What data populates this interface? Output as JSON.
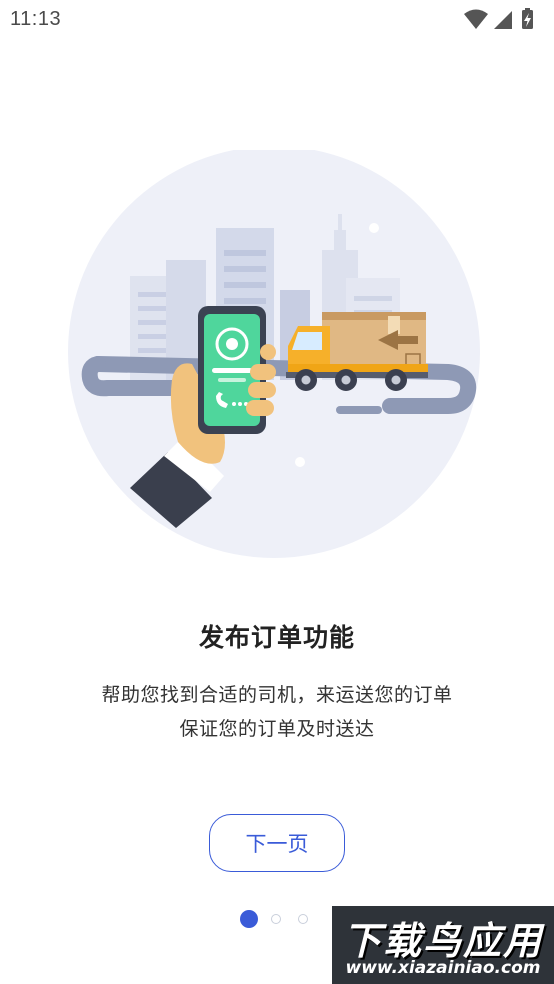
{
  "status_bar": {
    "time": "11:13",
    "icons": [
      "wifi-icon",
      "cell-signal-icon",
      "battery-charging-icon"
    ]
  },
  "illustration": {
    "description_icon": "phone-in-hand-and-delivery-truck-illustration",
    "colors": {
      "circle_bg": "#eef0f8",
      "phone_screen": "#4fd69c",
      "truck_cab": "#f6b02a",
      "cargo_box": "#e0b884",
      "road": "#8e99b5"
    }
  },
  "onboarding": {
    "title": "发布订单功能",
    "desc_line1": "帮助您找到合适的司机，来运送您的订单",
    "desc_line2": "保证您的订单及时送达",
    "next_label": "下一页",
    "page_total": 3,
    "page_current": 1
  },
  "watermark": {
    "main": "下载鸟应用",
    "sub": "www.xiazainiao.com"
  },
  "colors": {
    "accent": "#3a5bd8",
    "title_text": "#222222",
    "body_text": "#333333",
    "dot_inactive": "#c9cfdb"
  }
}
